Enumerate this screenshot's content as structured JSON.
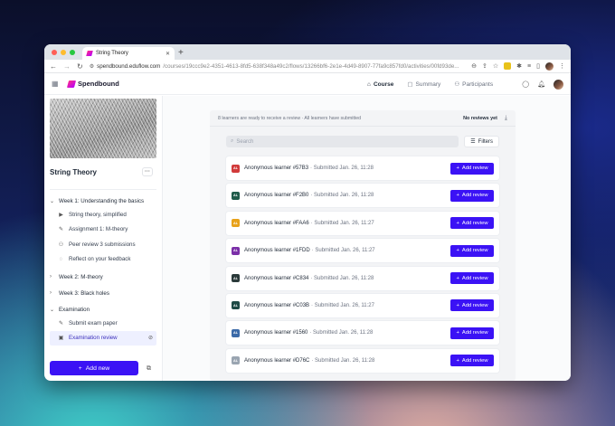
{
  "browser": {
    "tab_title": "String Theory",
    "url_host": "spendbound.eduflow.com",
    "url_path": "/courses/19ccc9e2-4351-4613-8fd5-638f348a49c2/flows/13266bf6-2e1e-4d49-8907-77fa9c857fd0/activities/00fd93de...",
    "traffic_lights": [
      "#ff5f57",
      "#febc2e",
      "#28c840"
    ]
  },
  "header": {
    "brand": "Spendbound",
    "nav": [
      {
        "label": "Course",
        "icon": "home-icon"
      },
      {
        "label": "Summary",
        "icon": "summary-icon"
      },
      {
        "label": "Participants",
        "icon": "participants-icon"
      }
    ]
  },
  "course": {
    "title": "String Theory"
  },
  "sidebar": {
    "sections": [
      {
        "label": "Week 1: Understanding the basics",
        "expanded": true,
        "items": [
          {
            "label": "String theory, simplified",
            "icon": "video-icon"
          },
          {
            "label": "Assignment 1: M-theory",
            "icon": "pencil-icon"
          },
          {
            "label": "Peer review 3 submissions",
            "icon": "people-icon"
          },
          {
            "label": "Reflect on your feedback",
            "icon": "chat-icon"
          }
        ]
      },
      {
        "label": "Week 2: M-theory",
        "expanded": false,
        "items": []
      },
      {
        "label": "Week 3: Black holes",
        "expanded": false,
        "items": []
      },
      {
        "label": "Examination",
        "expanded": true,
        "items": [
          {
            "label": "Submit exam paper",
            "icon": "pencil-icon"
          },
          {
            "label": "Examination review",
            "icon": "review-icon",
            "active": true
          }
        ]
      }
    ],
    "add_new": "Add new"
  },
  "main": {
    "banner_text": "8 learners are ready to receive a review · All learners have submitted",
    "no_reviews": "No reviews yet",
    "search_placeholder": "Search",
    "filters_label": "Filters",
    "add_review_label": "Add review",
    "accent": "#3b12f5",
    "learners": [
      {
        "initials": "AL",
        "name": "Anonymous learner #57B3",
        "submitted": "· Submitted Jan. 26, 11:28",
        "color": "#d13b3b"
      },
      {
        "initials": "AL",
        "name": "Anonymous learner #F2B0",
        "submitted": "· Submitted Jan. 26, 11:28",
        "color": "#1f5b4a"
      },
      {
        "initials": "AL",
        "name": "Anonymous learner #FAA6",
        "submitted": "· Submitted Jan. 26, 11:27",
        "color": "#e8a21a"
      },
      {
        "initials": "AL",
        "name": "Anonymous learner #1FDD",
        "submitted": "· Submitted Jan. 26, 11:27",
        "color": "#7b2fa8"
      },
      {
        "initials": "AL",
        "name": "Anonymous learner #C834",
        "submitted": "· Submitted Jan. 26, 11:28",
        "color": "#2b3a3a"
      },
      {
        "initials": "AL",
        "name": "Anonymous learner #C03B",
        "submitted": "· Submitted Jan. 26, 11:27",
        "color": "#1e4a45"
      },
      {
        "initials": "AL",
        "name": "Anonymous learner #1560",
        "submitted": "· Submitted Jan. 26, 11:28",
        "color": "#3b6aa8"
      },
      {
        "initials": "AL",
        "name": "Anonymous learner #D76C",
        "submitted": "· Submitted Jan. 26, 11:28",
        "color": "#9aa5b1"
      }
    ]
  }
}
